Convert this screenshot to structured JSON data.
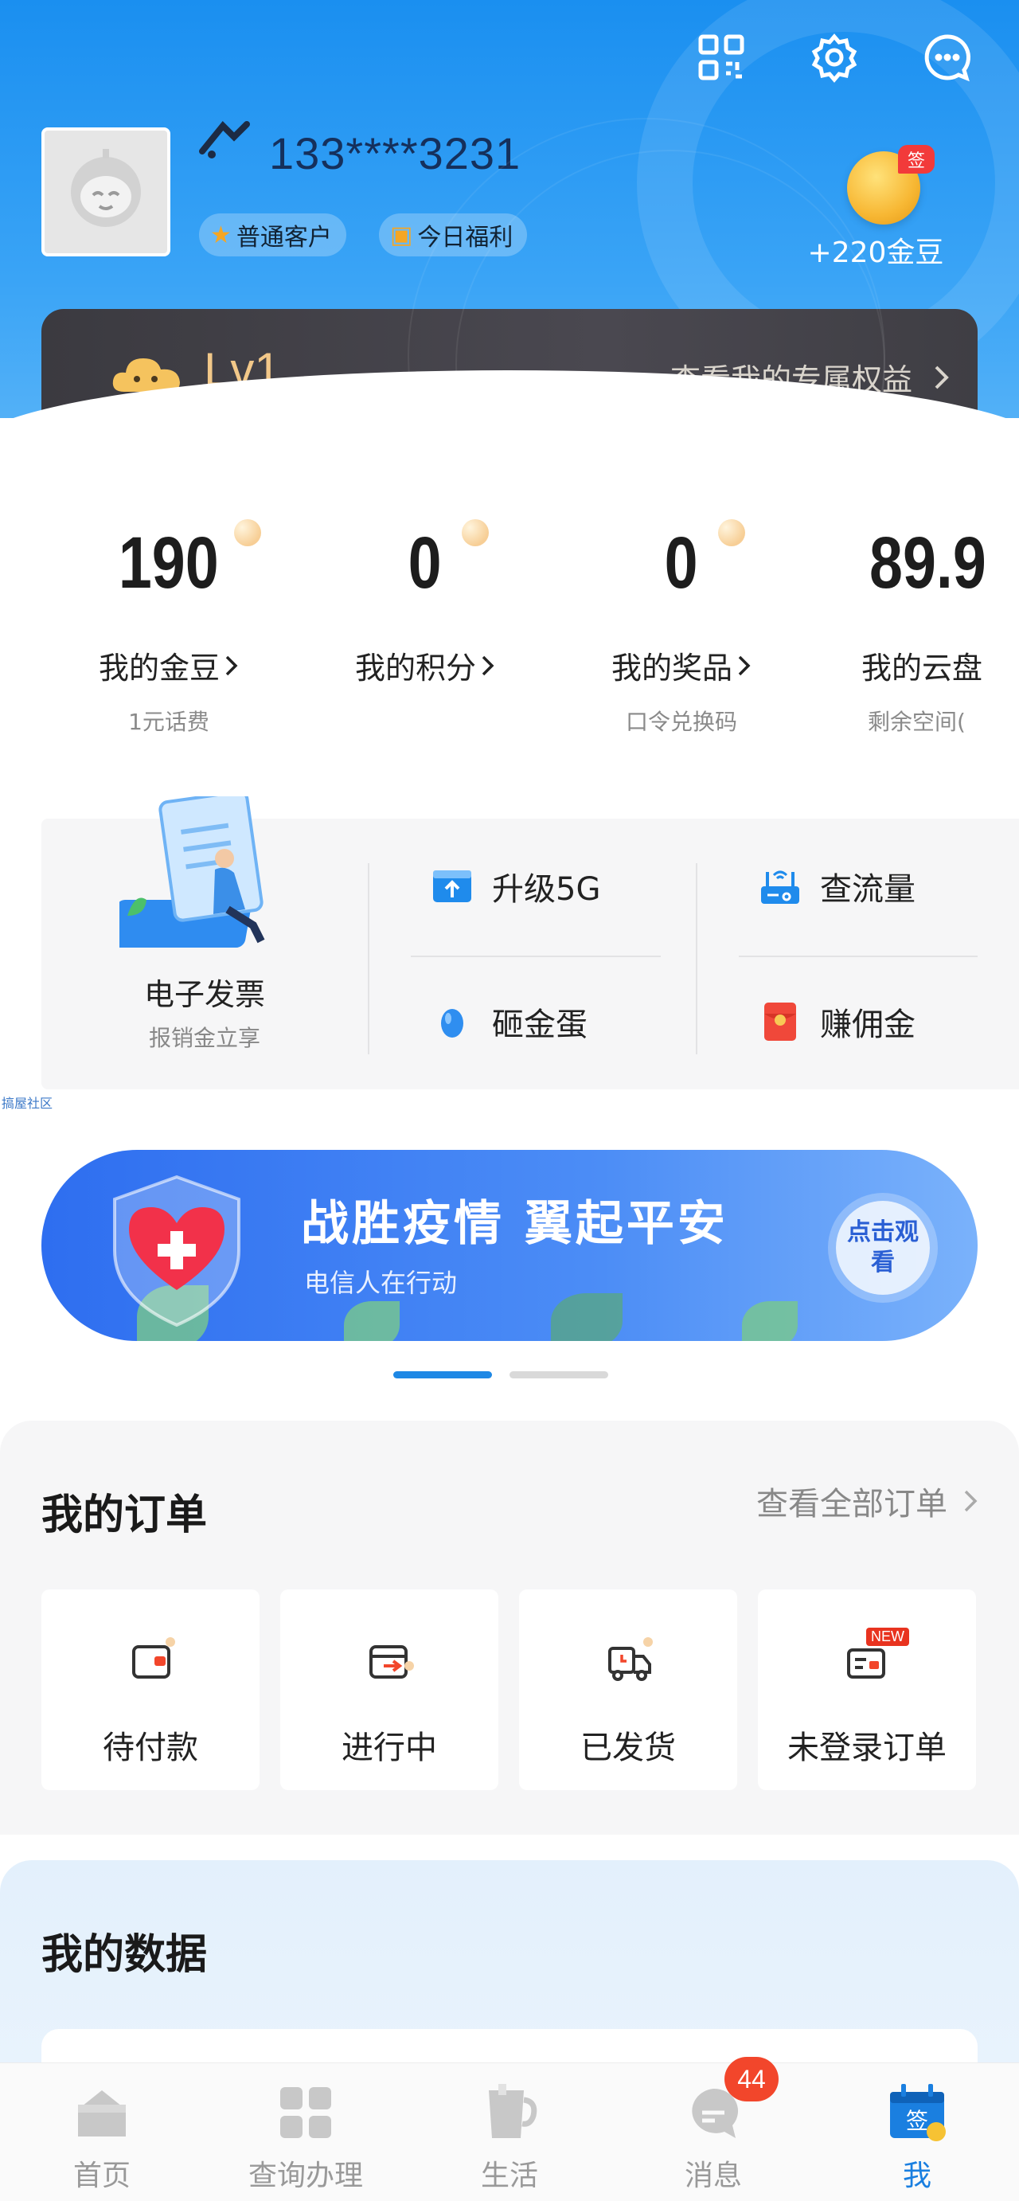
{
  "header": {
    "top_icons": [
      "qr-code-icon",
      "settings-icon",
      "chat-icon"
    ],
    "phone": "133****3231",
    "tags": {
      "customer": "普通客户",
      "welfare": "今日福利"
    },
    "coin": {
      "sign": "签",
      "text": "+220金豆"
    }
  },
  "member": {
    "level": "Lv1",
    "rights": "查看我的专属权益"
  },
  "stats": [
    {
      "value": "190",
      "label": "我的金豆",
      "sub": "1元话费"
    },
    {
      "value": "0",
      "label": "我的积分",
      "sub": ""
    },
    {
      "value": "0",
      "label": "我的奖品",
      "sub": "口令兑换码"
    },
    {
      "value": "89.9",
      "label": "我的云盘",
      "sub": "剩余空间("
    }
  ],
  "services": {
    "invoice": {
      "title": "电子发票",
      "sub": "报销金立享"
    },
    "items": [
      {
        "label": "升级5G",
        "icon": "upgrade-5g-icon"
      },
      {
        "label": "查流量",
        "icon": "router-icon"
      },
      {
        "label": "砸金蛋",
        "icon": "egg-icon"
      },
      {
        "label": "赚佣金",
        "icon": "red-envelope-icon"
      }
    ]
  },
  "watermark_tag": "搞屋社区",
  "banner": {
    "title": "战胜疫情 翼起平安",
    "subtitle": "电信人在行动",
    "button": "点击观看",
    "pages": 2,
    "active_page": 1
  },
  "orders": {
    "title": "我的订单",
    "view_all": "查看全部订单",
    "items": [
      {
        "label": "待付款",
        "icon": "wallet-icon"
      },
      {
        "label": "进行中",
        "icon": "in-progress-icon"
      },
      {
        "label": "已发货",
        "icon": "truck-icon"
      },
      {
        "label": "未登录订单",
        "icon": "card-icon",
        "badge": "NEW"
      }
    ]
  },
  "my_data": {
    "title": "我的数据"
  },
  "tabbar": {
    "active": "我",
    "items": [
      {
        "label": "首页",
        "icon": "home-icon"
      },
      {
        "label": "查询办理",
        "icon": "grid-icon"
      },
      {
        "label": "生活",
        "icon": "cup-icon"
      },
      {
        "label": "消息",
        "icon": "message-icon",
        "badge": "44"
      },
      {
        "label": "我",
        "icon": "calendar-sign-icon"
      }
    ]
  },
  "colors": {
    "header_blue": "#1a8ff0",
    "member_card": "#3b3a40",
    "level_gold": "#f2c889",
    "accent_blue": "#1a7fe0",
    "badge_red": "#f2462b"
  }
}
